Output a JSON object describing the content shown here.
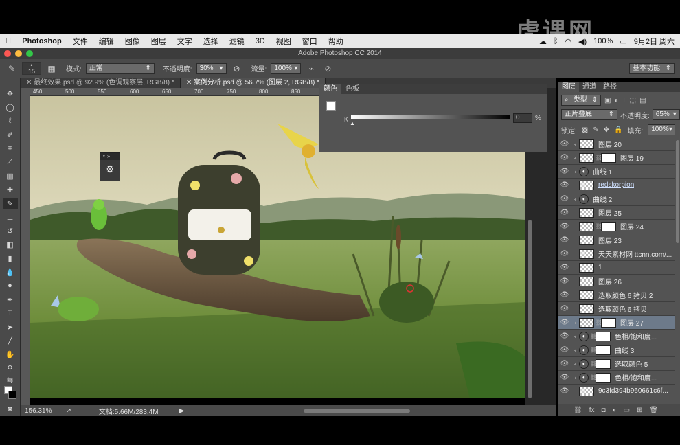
{
  "watermark": "虎课网",
  "menubar": {
    "app": "Photoshop",
    "items": [
      "文件",
      "编辑",
      "图像",
      "图层",
      "文字",
      "选择",
      "滤镜",
      "3D",
      "视图",
      "窗口",
      "帮助"
    ],
    "battery": "100%",
    "date": "9月2日 周六"
  },
  "window_title": "Adobe Photoshop CC 2014",
  "options": {
    "brush_size": "15",
    "mode_label": "模式:",
    "mode_value": "正常",
    "opacity_label": "不透明度:",
    "opacity_value": "30%",
    "flow_label": "流量:",
    "flow_value": "100%",
    "workspace": "基本功能"
  },
  "doc_tabs": [
    {
      "label": "最终效果.psd @ 92.9% (色调观察层, RGB/8) *"
    },
    {
      "label": "案例分析.psd @ 56.7% (图层 2, RGB/8) *"
    }
  ],
  "ruler_ticks": [
    "450",
    "500",
    "550",
    "600",
    "650",
    "700",
    "750",
    "800",
    "850",
    "900",
    "950",
    "1000",
    "1050",
    "1100",
    "1150"
  ],
  "color_panel": {
    "tabs": [
      "颜色",
      "色板"
    ],
    "channel": "K",
    "value": "0",
    "unit": "%"
  },
  "status": {
    "zoom": "156.31%",
    "doc": "文档:5.66M/283.4M"
  },
  "layers_panel": {
    "tabs": [
      "图层",
      "通道",
      "路径"
    ],
    "filter": "类型",
    "blend": "正片叠底",
    "opacity_label": "不透明度:",
    "opacity": "65%",
    "lock_label": "锁定:",
    "fill_label": "填充:",
    "fill": "100%",
    "layers": [
      {
        "name": "图层 20",
        "clip": true,
        "type": "pixel"
      },
      {
        "name": "图层 19",
        "clip": true,
        "type": "mask"
      },
      {
        "name": "曲线 1",
        "clip": true,
        "type": "adj"
      },
      {
        "name": "redskorpion",
        "clip": false,
        "type": "smart"
      },
      {
        "name": "曲线 2",
        "clip": true,
        "type": "adj"
      },
      {
        "name": "图层 25",
        "clip": false,
        "type": "pixel"
      },
      {
        "name": "图层 24",
        "clip": false,
        "type": "mask"
      },
      {
        "name": "图层 23",
        "clip": false,
        "type": "pixel"
      },
      {
        "name": "天天素材网 ttcnn.com/...",
        "clip": false,
        "type": "smart"
      },
      {
        "name": "1",
        "clip": false,
        "type": "pixel"
      },
      {
        "name": "图层 26",
        "clip": false,
        "type": "pixel"
      },
      {
        "name": "选取颜色 6 拷贝 2",
        "clip": false,
        "type": "pixel"
      },
      {
        "name": "选取颜色 6 拷贝",
        "clip": false,
        "type": "pixel"
      },
      {
        "name": "图层 27",
        "clip": true,
        "type": "mask",
        "selected": true
      },
      {
        "name": "色相/饱和度...",
        "clip": true,
        "type": "adjmask"
      },
      {
        "name": "曲线 3",
        "clip": true,
        "type": "adjmask"
      },
      {
        "name": "选取颜色 5",
        "clip": true,
        "type": "adjmask"
      },
      {
        "name": "色相/饱和度...",
        "clip": true,
        "type": "adjmask"
      },
      {
        "name": "9c3fd394b960661c6f...",
        "clip": false,
        "type": "smart"
      }
    ]
  }
}
